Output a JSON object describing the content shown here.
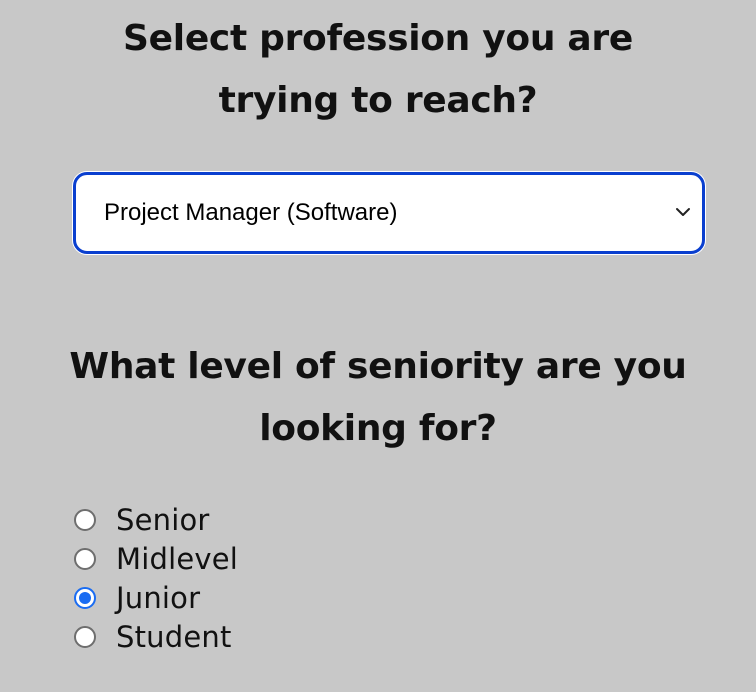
{
  "profession_section": {
    "heading": "Select profession you are trying to reach?",
    "select": {
      "selected_value": "Project Manager (Software)"
    }
  },
  "seniority_section": {
    "heading": "What level of seniority are you looking for?",
    "options": [
      {
        "label": "Senior",
        "checked": false
      },
      {
        "label": "Midlevel",
        "checked": false
      },
      {
        "label": "Junior",
        "checked": true
      },
      {
        "label": "Student",
        "checked": false
      }
    ]
  },
  "colors": {
    "background": "#c8c8c8",
    "select_border": "#0a3fcf",
    "radio_checked": "#1a6cf2"
  },
  "icons": {
    "select_arrow": "chevron-down-icon"
  }
}
